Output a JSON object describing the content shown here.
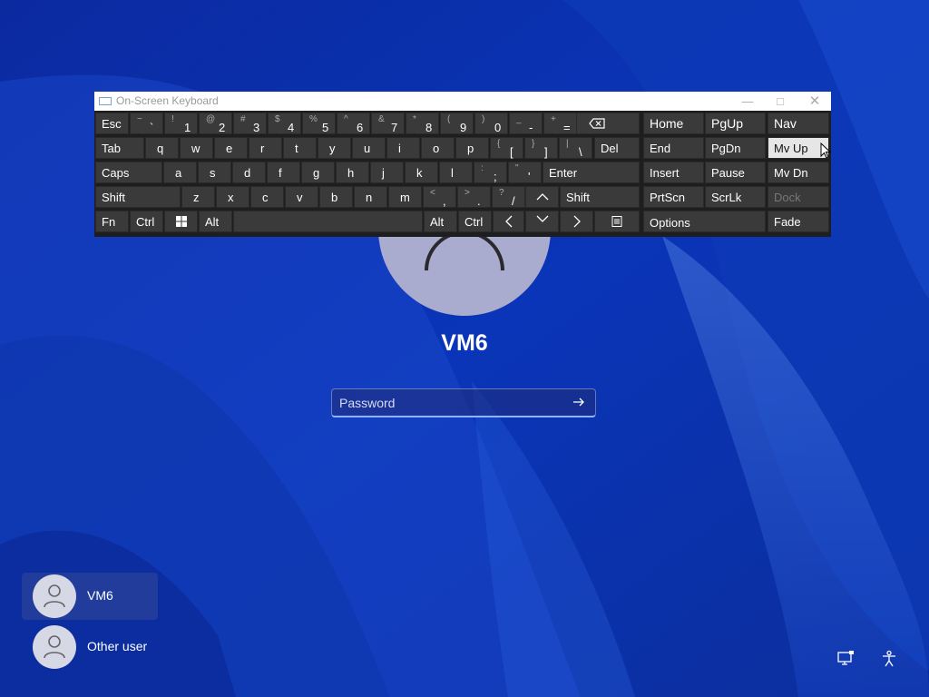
{
  "login": {
    "username": "VM6",
    "password_placeholder": "Password"
  },
  "users": [
    {
      "label": "VM6",
      "selected": true
    },
    {
      "label": "Other user",
      "selected": false
    }
  ],
  "osk": {
    "title": "On-Screen Keyboard",
    "window_buttons": [
      "minimize",
      "maximize",
      "close"
    ],
    "keys": {
      "esc": "Esc",
      "tab": "Tab",
      "caps": "Caps",
      "shift_l": "Shift",
      "fn": "Fn",
      "ctrl_l": "Ctrl",
      "alt_l": "Alt",
      "alt_r": "Alt",
      "ctrl_r": "Ctrl",
      "del": "Del",
      "enter": "Enter",
      "shift_r": "Shift",
      "home": "Home",
      "pgup": "PgUp",
      "nav": "Nav",
      "end": "End",
      "pgdn": "PgDn",
      "mvup": "Mv Up",
      "insert": "Insert",
      "pause": "Pause",
      "mvdn": "Mv Dn",
      "prtscn": "PrtScn",
      "scrlk": "ScrLk",
      "dock": "Dock",
      "options": "Options",
      "fade": "Fade"
    },
    "row1": [
      {
        "s": "~",
        "m": "`"
      },
      {
        "s": "!",
        "m": "1"
      },
      {
        "s": "@",
        "m": "2"
      },
      {
        "s": "#",
        "m": "3"
      },
      {
        "s": "$",
        "m": "4"
      },
      {
        "s": "%",
        "m": "5"
      },
      {
        "s": "^",
        "m": "6"
      },
      {
        "s": "&",
        "m": "7"
      },
      {
        "s": "*",
        "m": "8"
      },
      {
        "s": "(",
        "m": "9"
      },
      {
        "s": ")",
        "m": "0"
      },
      {
        "s": "_",
        "m": "-"
      },
      {
        "s": "+",
        "m": "="
      }
    ],
    "row2": [
      "q",
      "w",
      "e",
      "r",
      "t",
      "y",
      "u",
      "i",
      "o",
      "p"
    ],
    "row2_sym": [
      {
        "s": "{",
        "m": "["
      },
      {
        "s": "}",
        "m": "]"
      },
      {
        "s": "|",
        "m": "\\"
      }
    ],
    "row3": [
      "a",
      "s",
      "d",
      "f",
      "g",
      "h",
      "j",
      "k",
      "l"
    ],
    "row3_sym": [
      {
        "s": ":",
        "m": ";"
      },
      {
        "s": "\"",
        "m": "'"
      }
    ],
    "row4": [
      "z",
      "x",
      "c",
      "v",
      "b",
      "n",
      "m"
    ],
    "row4_sym": [
      {
        "s": "<",
        "m": ","
      },
      {
        "s": ">",
        "m": "."
      },
      {
        "s": "?",
        "m": "/"
      }
    ]
  },
  "icons": {
    "network": "network-icon",
    "accessibility": "accessibility-icon",
    "windows": "windows-logo-icon",
    "backspace": "backspace-icon",
    "menu": "context-menu-icon"
  },
  "colors": {
    "background": "#0a2fa8",
    "osk_key": "#3a3a3a",
    "osk_key_highlight": "#e6e6e6"
  }
}
